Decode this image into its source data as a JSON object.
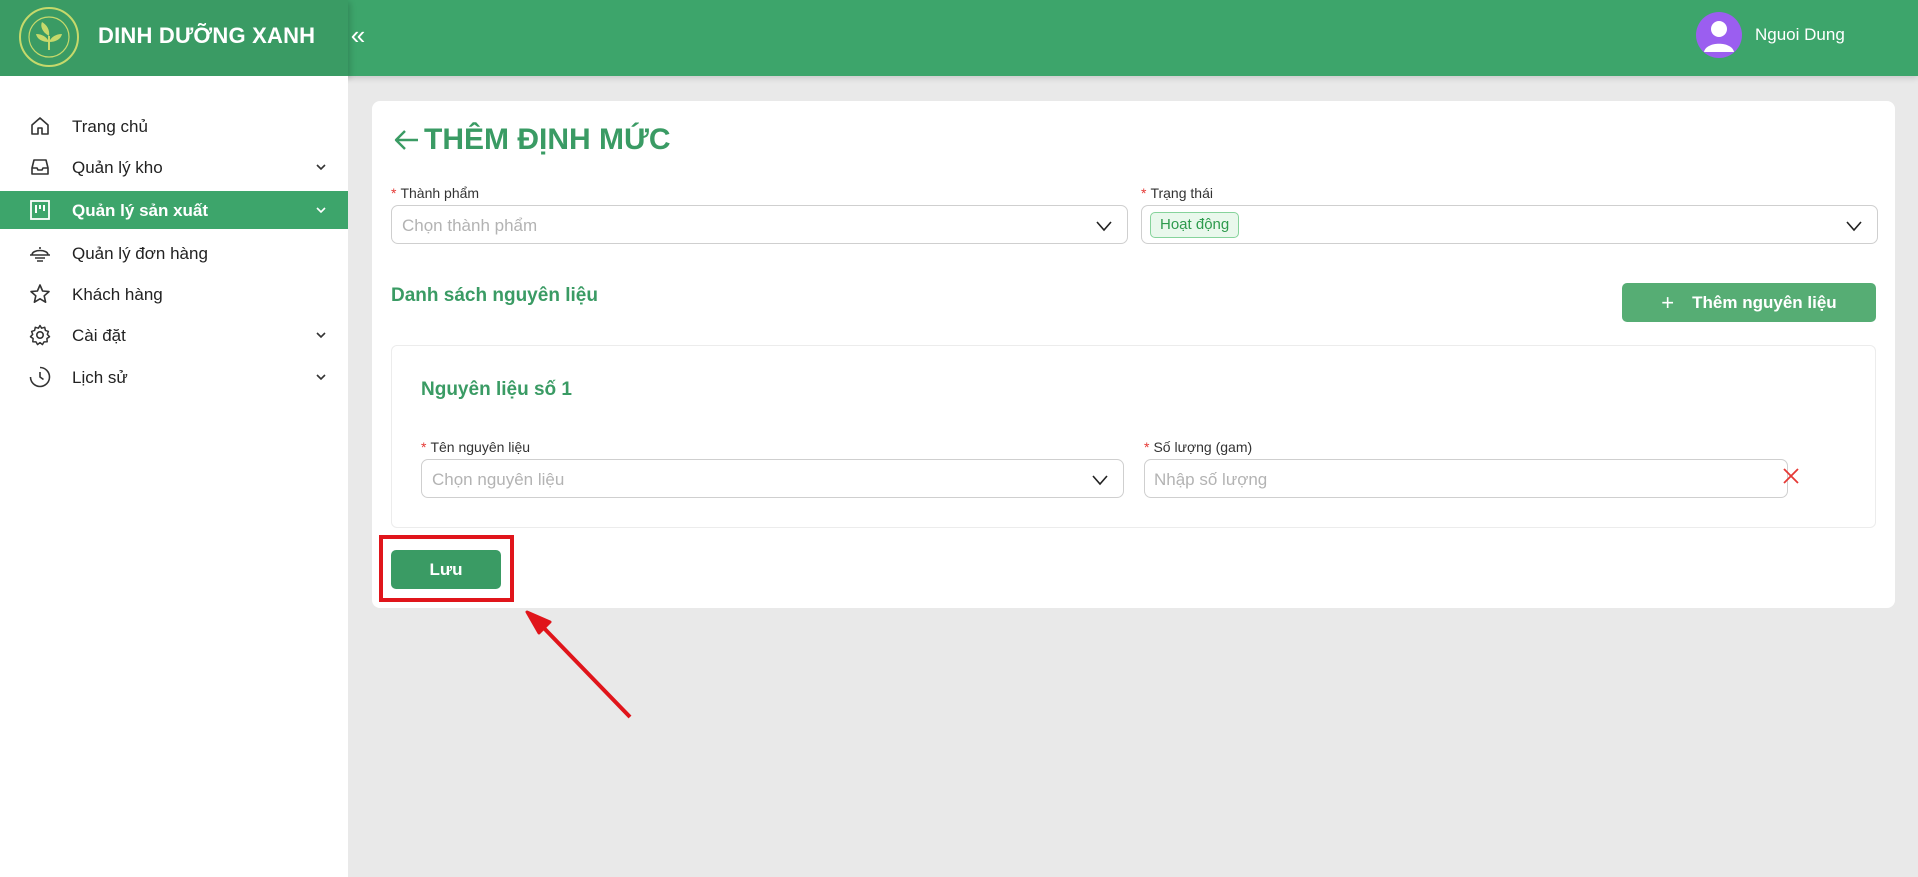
{
  "header": {
    "brand": "DINH DƯỠNG XANH",
    "collapse_icon": "«",
    "user_name": "Nguoi Dung"
  },
  "sidebar": {
    "items": [
      {
        "label": "Trang chủ",
        "icon": "home-icon",
        "active": false,
        "has_submenu": false
      },
      {
        "label": "Quản lý kho",
        "icon": "inbox-icon",
        "active": false,
        "has_submenu": true
      },
      {
        "label": "Quản lý sản xuất",
        "icon": "project-icon",
        "active": true,
        "has_submenu": true
      },
      {
        "label": "Quản lý đơn hàng",
        "icon": "delivery-icon",
        "active": false,
        "has_submenu": false
      },
      {
        "label": "Khách hàng",
        "icon": "star-icon",
        "active": false,
        "has_submenu": false
      },
      {
        "label": "Cài đặt",
        "icon": "gear-icon",
        "active": false,
        "has_submenu": true
      },
      {
        "label": "Lịch sử",
        "icon": "clock-icon",
        "active": false,
        "has_submenu": true
      }
    ]
  },
  "main": {
    "title": "THÊM ĐỊNH MỨC",
    "product_field": {
      "label": "Thành phẩm",
      "placeholder": "Chọn thành phẩm"
    },
    "status_field": {
      "label": "Trạng thái",
      "value": "Hoạt động"
    },
    "ingredients_section_title": "Danh sách nguyên liệu",
    "add_ingredient_label": "Thêm nguyên liệu",
    "ingredients": [
      {
        "title": "Nguyên liệu số 1",
        "name_label": "Tên nguyên liệu",
        "name_placeholder": "Chọn nguyên liệu",
        "qty_label": "Số lượng (gam)",
        "qty_placeholder": "Nhập số lượng"
      }
    ],
    "save_label": "Lưu"
  },
  "colors": {
    "primary": "#3da56b",
    "sidebar_active": "#3da56b",
    "highlight": "#e0151b",
    "avatar": "#9b5ef0"
  }
}
